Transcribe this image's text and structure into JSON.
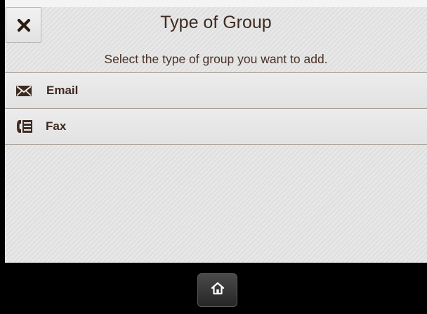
{
  "header": {
    "title": "Type of Group",
    "subtitle": "Select the type of group you want to add."
  },
  "options": [
    {
      "label": "Email",
      "icon": "envelope-icon"
    },
    {
      "label": "Fax",
      "icon": "fax-icon"
    }
  ],
  "icons": {
    "close": "close-icon",
    "home": "home-icon"
  },
  "colors": {
    "text": "#3e2a20",
    "panel": "#e4e4e4",
    "bezel": "#000000"
  }
}
